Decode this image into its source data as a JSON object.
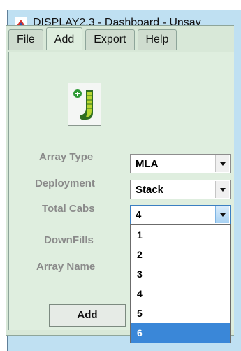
{
  "window": {
    "title": "DISPLAY2.3 - Dashboard - Unsav"
  },
  "tabs": [
    "File",
    "Add",
    "Export",
    "Help"
  ],
  "colors": {
    "selection": "#3a87d8",
    "panel": "#dfeedf",
    "titlebar": "#bfe0f2"
  },
  "toolbar": {
    "icon": "add-array-icon"
  },
  "form": {
    "array_type": {
      "label": "Array Type",
      "value": "MLA"
    },
    "deployment": {
      "label": "Deployment",
      "value": "Stack"
    },
    "total_cabs": {
      "label": "Total Cabs",
      "value": "4"
    },
    "downfills": {
      "label": "DownFills"
    },
    "array_name": {
      "label": "Array Name"
    }
  },
  "dropdown": {
    "options": [
      "1",
      "2",
      "3",
      "4",
      "5",
      "6"
    ],
    "highlighted": "6"
  },
  "add_button": "Add"
}
